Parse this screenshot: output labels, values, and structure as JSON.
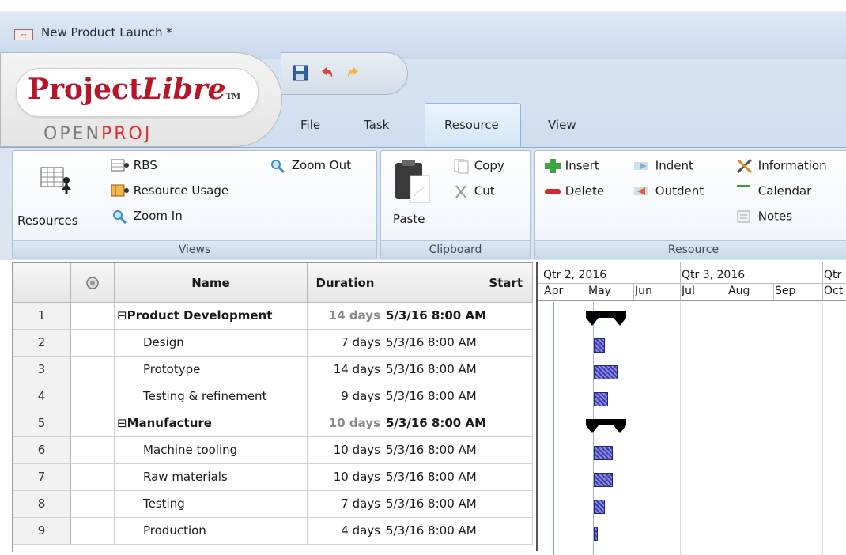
{
  "window": {
    "title": "New Product Launch *"
  },
  "logo": {
    "brand_main": "Project",
    "brand_italic": "Libre",
    "tm": "TM",
    "sub_left": "OPEN",
    "sub_right": "PROJ"
  },
  "tabs": [
    {
      "label": "File"
    },
    {
      "label": "Task"
    },
    {
      "label": "Resource"
    },
    {
      "label": "View"
    }
  ],
  "ribbon": {
    "views": {
      "label": "Views",
      "resources": "Resources",
      "rbs": "RBS",
      "resource_usage": "Resource Usage",
      "zoom_in": "Zoom In",
      "zoom_out": "Zoom Out"
    },
    "clipboard": {
      "label": "Clipboard",
      "paste": "Paste",
      "copy": "Copy",
      "cut": "Cut"
    },
    "resource": {
      "label": "Resource",
      "insert": "Insert",
      "delete": "Delete",
      "indent": "Indent",
      "outdent": "Outdent",
      "information": "Information",
      "calendar": "Calendar",
      "notes": "Notes"
    }
  },
  "table": {
    "headers": {
      "name": "Name",
      "duration": "Duration",
      "start": "Start"
    },
    "rows": [
      {
        "num": "1",
        "name": "Product Development",
        "duration": "14 days",
        "start": "5/3/16 8:00 AM",
        "summary": true
      },
      {
        "num": "2",
        "name": "Design",
        "duration": "7 days",
        "start": "5/3/16 8:00 AM",
        "summary": false
      },
      {
        "num": "3",
        "name": "Prototype",
        "duration": "14 days",
        "start": "5/3/16 8:00 AM",
        "summary": false
      },
      {
        "num": "4",
        "name": "Testing & refinement",
        "duration": "9 days",
        "start": "5/3/16 8:00 AM",
        "summary": false
      },
      {
        "num": "5",
        "name": "Manufacture",
        "duration": "10 days",
        "start": "5/3/16 8:00 AM",
        "summary": true
      },
      {
        "num": "6",
        "name": "Machine tooling",
        "duration": "10 days",
        "start": "5/3/16 8:00 AM",
        "summary": false
      },
      {
        "num": "7",
        "name": "Raw materials",
        "duration": "10 days",
        "start": "5/3/16 8:00 AM",
        "summary": false
      },
      {
        "num": "8",
        "name": "Testing",
        "duration": "7 days",
        "start": "5/3/16 8:00 AM",
        "summary": false
      },
      {
        "num": "9",
        "name": "Production",
        "duration": "4 days",
        "start": "5/3/16 8:00 AM",
        "summary": false
      }
    ]
  },
  "gantt": {
    "quarters": [
      "Qtr 2, 2016",
      "Qtr 3, 2016",
      "Qtr"
    ],
    "months": [
      "Apr",
      "May",
      "Jun",
      "Jul",
      "Aug",
      "Sep",
      "Oct"
    ]
  }
}
